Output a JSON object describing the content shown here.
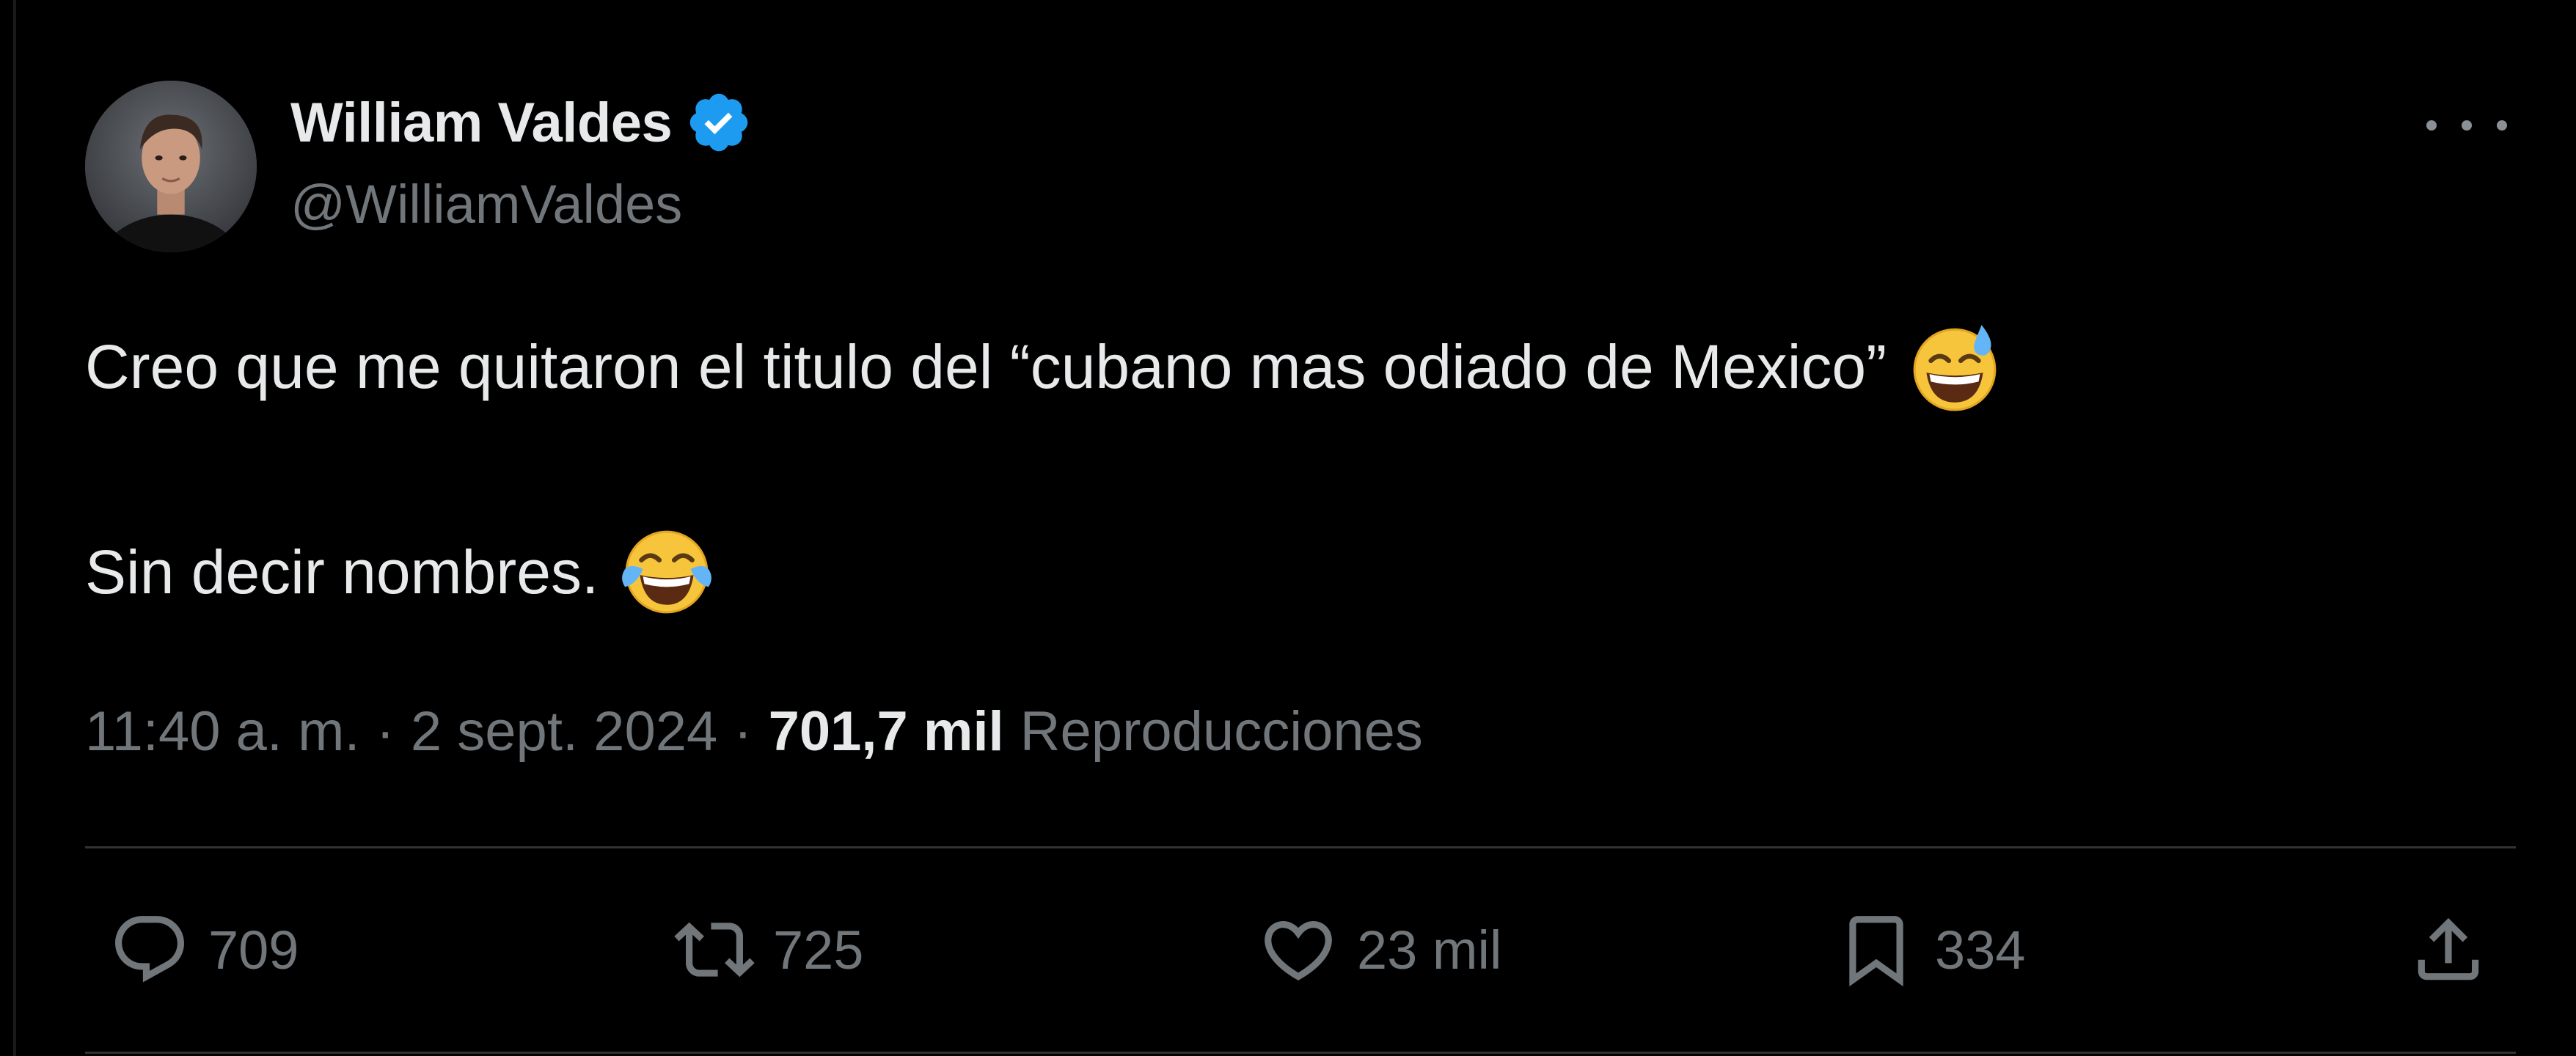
{
  "user": {
    "display_name": "William Valdes",
    "handle": "@WilliamValdes",
    "verified": true,
    "verified_color": "#1d9bf0"
  },
  "tweet": {
    "line1": "Creo que me quitaron el titulo del “cubano mas odiado de Mexico”",
    "line1_emoji": "grinning-face-with-sweat",
    "line2": "Sin decir nombres.",
    "line2_emoji": "face-with-tears-of-joy"
  },
  "meta": {
    "time": "11:40 a. m.",
    "date": "2 sept. 2024",
    "separator": "·",
    "views_count": "701,7 mil",
    "views_label": "Reproducciones"
  },
  "actions": {
    "replies": "709",
    "reposts": "725",
    "likes": "23 mil",
    "bookmarks": "334"
  },
  "icons": {
    "more": "more-horizontal-icon",
    "reply": "reply-icon",
    "repost": "repost-icon",
    "like": "heart-icon",
    "bookmark": "bookmark-icon",
    "share": "share-icon"
  },
  "colors": {
    "background": "#000000",
    "text_primary": "#e7e9ea",
    "text_secondary": "#71767b",
    "divider": "#2f3336"
  }
}
